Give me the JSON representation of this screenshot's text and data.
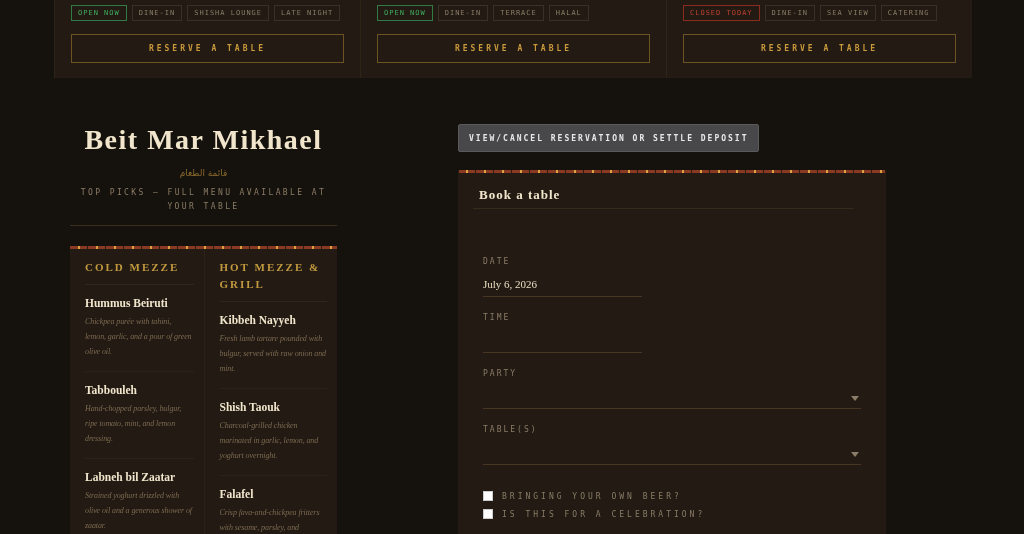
{
  "venues": [
    {
      "tags": [
        {
          "label": "OPEN NOW",
          "kind": "open"
        },
        {
          "label": "DINE-IN",
          "kind": "feature"
        },
        {
          "label": "SHISHA LOUNGE",
          "kind": "feature"
        },
        {
          "label": "LATE NIGHT",
          "kind": "feature"
        }
      ],
      "button": "RESERVE A TABLE"
    },
    {
      "tags": [
        {
          "label": "OPEN NOW",
          "kind": "open"
        },
        {
          "label": "DINE-IN",
          "kind": "feature"
        },
        {
          "label": "TERRACE",
          "kind": "feature"
        },
        {
          "label": "HALAL",
          "kind": "feature"
        }
      ],
      "button": "RESERVE A TABLE"
    },
    {
      "tags": [
        {
          "label": "CLOSED TODAY",
          "kind": "closed"
        },
        {
          "label": "DINE-IN",
          "kind": "feature"
        },
        {
          "label": "SEA VIEW",
          "kind": "feature"
        },
        {
          "label": "CATERING",
          "kind": "feature"
        }
      ],
      "button": "RESERVE A TABLE"
    }
  ],
  "menu": {
    "title": "Beit Mar Mikhael",
    "arabic": "قائمة الطعام",
    "subtitle": "TOP PICKS — FULL MENU AVAILABLE AT YOUR TABLE",
    "sections": [
      {
        "heading": "COLD MEZZE",
        "items": [
          {
            "name": "Hummus Beiruti",
            "description": "Chickpea purée with tahini, lemon, garlic, and a pour of green olive oil."
          },
          {
            "name": "Tabbouleh",
            "description": "Hand-chopped parsley, bulgur, ripe tomato, mint, and lemon dressing."
          },
          {
            "name": "Labneh bil Zaatar",
            "description": "Strained yoghurt drizzled with olive oil and a generous shower of zaatar."
          }
        ]
      },
      {
        "heading": "HOT MEZZE & GRILL",
        "items": [
          {
            "name": "Kibbeh Nayyeh",
            "description": "Fresh lamb tartare pounded with bulgur, served with raw onion and mint."
          },
          {
            "name": "Shish Taouk",
            "description": "Charcoal-grilled chicken marinated in garlic, lemon, and yoghurt overnight."
          },
          {
            "name": "Falafel",
            "description": "Crisp fava-and-chickpea fritters with sesame, parsley, and"
          }
        ]
      }
    ]
  },
  "manage_button": "VIEW/CANCEL RESERVATION OR SETTLE DEPOSIT",
  "booking": {
    "title": "Book a table",
    "fields": [
      {
        "kind": "text",
        "label": "DATE",
        "value": "July 6, 2026"
      },
      {
        "kind": "text",
        "label": "TIME"
      },
      {
        "kind": "select",
        "label": "PARTY"
      },
      {
        "kind": "select",
        "label": "TABLE(S)"
      }
    ],
    "checkboxes": [
      {
        "label": "BRINGING YOUR OWN BEER?",
        "checked": false
      },
      {
        "label": "IS THIS FOR A CELEBRATION?",
        "checked": false
      }
    ]
  }
}
